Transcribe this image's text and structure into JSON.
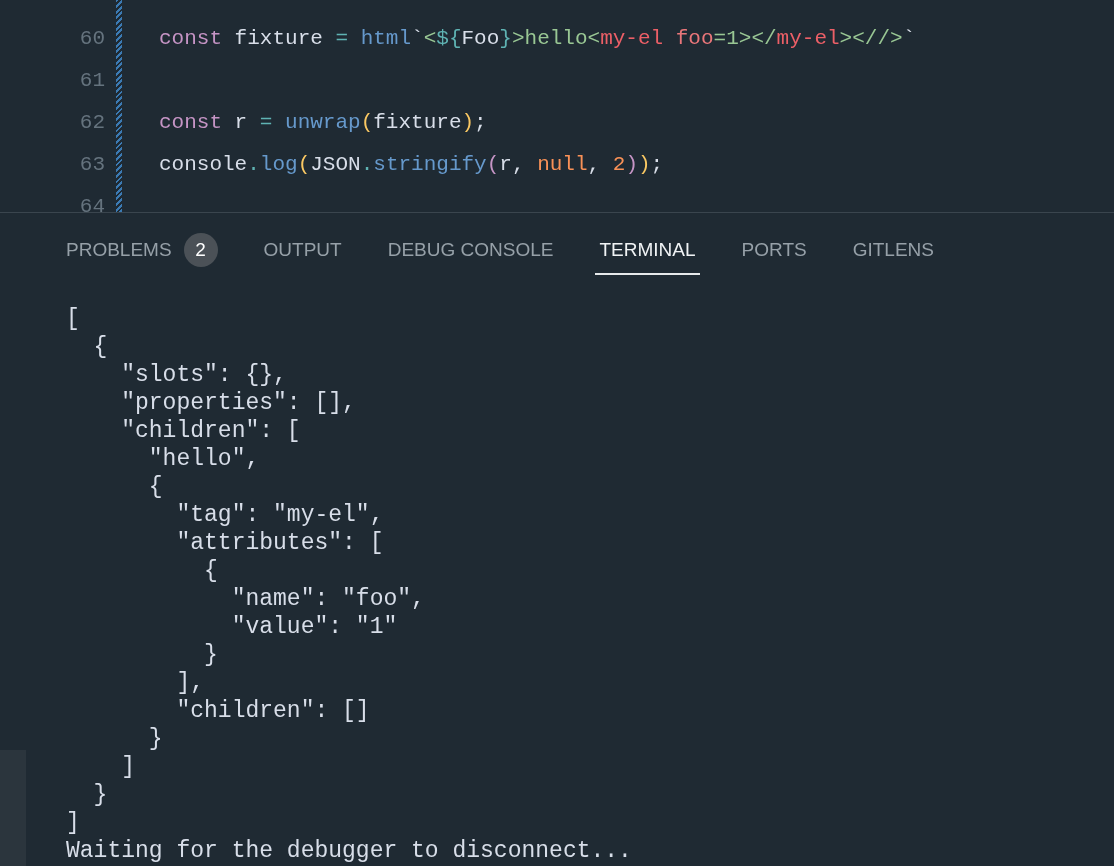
{
  "editor": {
    "lines": [
      {
        "number": "60",
        "tokens": [
          {
            "kind": "keyword",
            "text": "const"
          },
          {
            "kind": "plain",
            "text": " fixture "
          },
          {
            "kind": "operator",
            "text": "="
          },
          {
            "kind": "function",
            "text": " html"
          },
          {
            "kind": "plain",
            "text": "`"
          },
          {
            "kind": "string",
            "text": "<"
          },
          {
            "kind": "operator",
            "text": "${"
          },
          {
            "kind": "plain",
            "text": "Foo"
          },
          {
            "kind": "operator",
            "text": "}"
          },
          {
            "kind": "string",
            "text": ">hello<"
          },
          {
            "kind": "tag",
            "text": "my-el"
          },
          {
            "kind": "attr",
            "text": " foo"
          },
          {
            "kind": "string",
            "text": "=1></"
          },
          {
            "kind": "tag",
            "text": "my-el"
          },
          {
            "kind": "string",
            "text": "></"
          },
          {
            "kind": "string",
            "text": "/>"
          },
          {
            "kind": "plain",
            "text": "`"
          }
        ]
      },
      {
        "number": "61"
      },
      {
        "number": "62",
        "tokens": [
          {
            "kind": "keyword",
            "text": "const"
          },
          {
            "kind": "plain",
            "text": " r "
          },
          {
            "kind": "operator",
            "text": "="
          },
          {
            "kind": "function",
            "text": " unwrap"
          },
          {
            "kind": "paren",
            "text": "("
          },
          {
            "kind": "plain",
            "text": "fixture"
          },
          {
            "kind": "paren",
            "text": ")"
          },
          {
            "kind": "plain",
            "text": ";"
          }
        ]
      },
      {
        "number": "63",
        "tokens": [
          {
            "kind": "plain",
            "text": "console"
          },
          {
            "kind": "operator",
            "text": "."
          },
          {
            "kind": "function",
            "text": "log"
          },
          {
            "kind": "paren",
            "text": "("
          },
          {
            "kind": "plain",
            "text": "JSON"
          },
          {
            "kind": "operator",
            "text": "."
          },
          {
            "kind": "function",
            "text": "stringify"
          },
          {
            "kind": "paren2",
            "text": "("
          },
          {
            "kind": "plain",
            "text": "r, "
          },
          {
            "kind": "number",
            "text": "null"
          },
          {
            "kind": "plain",
            "text": ", "
          },
          {
            "kind": "number",
            "text": "2"
          },
          {
            "kind": "paren2",
            "text": ")"
          },
          {
            "kind": "paren",
            "text": ")"
          },
          {
            "kind": "plain",
            "text": ";"
          }
        ]
      },
      {
        "number": "64"
      }
    ]
  },
  "panel": {
    "tabs": [
      {
        "label": "PROBLEMS",
        "badge": "2",
        "selected": false
      },
      {
        "label": "OUTPUT",
        "selected": false
      },
      {
        "label": "DEBUG CONSOLE",
        "selected": false
      },
      {
        "label": "TERMINAL",
        "selected": true
      },
      {
        "label": "PORTS",
        "selected": false
      },
      {
        "label": "GITLENS",
        "selected": false
      }
    ],
    "terminal": {
      "lines": [
        "[",
        "  {",
        "    \"slots\": {},",
        "    \"properties\": [],",
        "    \"children\": [",
        "      \"hello\",",
        "      {",
        "        \"tag\": \"my-el\",",
        "        \"attributes\": [",
        "          {",
        "            \"name\": \"foo\",",
        "            \"value\": \"1\"",
        "          }",
        "        ],",
        "        \"children\": []",
        "      }",
        "    ]",
        "  }",
        "]",
        "Waiting for the debugger to disconnect..."
      ]
    }
  }
}
